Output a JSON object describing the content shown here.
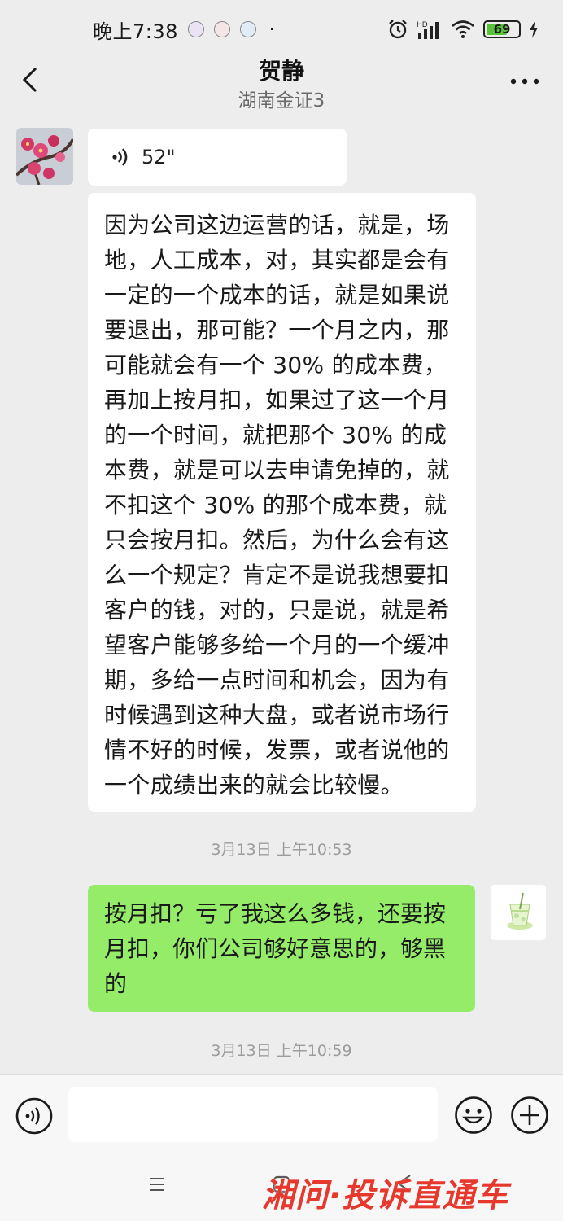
{
  "status_bar": {
    "time": "晚上7:38",
    "dot": "·",
    "battery": "69"
  },
  "header": {
    "title": "贺静",
    "subtitle": "湖南金证3"
  },
  "messages": {
    "voice_duration": "52\"",
    "received_text": "因为公司这边运营的话，就是，场地，人工成本，对，其实都是会有一定的一个成本的话，就是如果说要退出，那可能？一个月之内，那可能就会有一个 30% 的成本费，再加上按月扣，如果过了这一个月的一个时间，就把那个 30% 的成本费，就是可以去申请免掉的，就不扣这个 30% 的那个成本费，就只会按月扣。然后，为什么会有这么一个规定？肯定不是说我想要扣客户的钱，对的，只是说，就是希望客户能够多给一个月的一个缓冲期，多给一点时间和机会，因为有时候遇到这种大盘，或者说市场行情不好的时候，发票，或者说他的一个成绩出来的就会比较慢。",
    "timestamp_1": "3月13日 上午10:53",
    "sent_text": "按月扣？亏了我这么多钱，还要按月扣，你们公司够好意思的，够黑的",
    "timestamp_2": "3月13日 上午10:59"
  },
  "input": {
    "value": ""
  },
  "watermark": "湘问·投诉直通车",
  "icons": {
    "back": "chevron-left-icon",
    "more": "more-icon",
    "voice": "voice-wave-icon",
    "emoji": "emoji-icon",
    "plus": "plus-icon"
  },
  "colors": {
    "background": "#ededed",
    "sent_bubble": "#95ec69",
    "received_bubble": "#ffffff",
    "watermark": "#e6382c",
    "battery": "#58c33a"
  }
}
